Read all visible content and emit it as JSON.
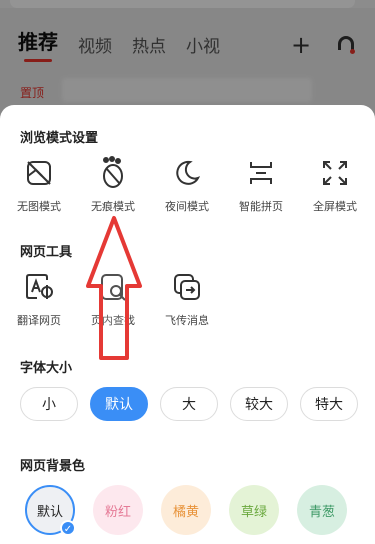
{
  "background": {
    "tabs": [
      "推荐",
      "视频",
      "热点",
      "小视"
    ],
    "pin_label": "置顶"
  },
  "browse_mode": {
    "title": "浏览模式设置",
    "items": [
      {
        "label": "无图模式",
        "icon": "no-image-icon"
      },
      {
        "label": "无痕模式",
        "icon": "incognito-icon"
      },
      {
        "label": "夜间模式",
        "icon": "moon-icon"
      },
      {
        "label": "智能拼页",
        "icon": "smart-page-icon"
      },
      {
        "label": "全屏模式",
        "icon": "fullscreen-icon"
      }
    ]
  },
  "web_tools": {
    "title": "网页工具",
    "items": [
      {
        "label": "翻译网页",
        "icon": "translate-icon"
      },
      {
        "label": "页内查找",
        "icon": "find-in-page-icon"
      },
      {
        "label": "飞传消息",
        "icon": "send-message-icon"
      }
    ]
  },
  "font_size": {
    "title": "字体大小",
    "options": [
      "小",
      "默认",
      "大",
      "较大",
      "特大"
    ],
    "selected": "默认"
  },
  "bg_color": {
    "title": "网页背景色",
    "options": [
      {
        "label": "默认",
        "bg": "#eef0f3",
        "fg": "#222222"
      },
      {
        "label": "粉红",
        "bg": "#fde8ee",
        "fg": "#e57a96"
      },
      {
        "label": "橘黄",
        "bg": "#fdecd9",
        "fg": "#e8933a"
      },
      {
        "label": "草绿",
        "bg": "#e4f3d6",
        "fg": "#6aa83d"
      },
      {
        "label": "青葱",
        "bg": "#d7efe1",
        "fg": "#3f9a67"
      }
    ],
    "selected": "默认",
    "check_mark": "✓"
  },
  "colors": {
    "accent": "#3a8ef6",
    "annotation_arrow": "#e53935"
  }
}
